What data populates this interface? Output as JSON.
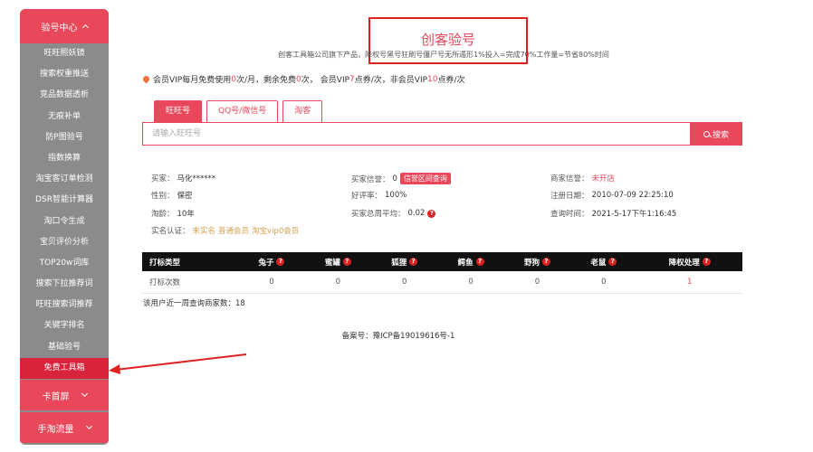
{
  "sidebar": {
    "header": "验号中心",
    "items": [
      "旺旺照妖镜",
      "搜索权重推送",
      "竞品数据透析",
      "无痕补单",
      "防P图验号",
      "指数换算",
      "淘宝客订单检测",
      "DSR智能计算器",
      "淘口令生成",
      "宝贝评价分析",
      "TOP20w词库",
      "搜索下拉推荐词",
      "旺旺搜索词推荐",
      "关键字排名",
      "基础验号",
      "免费工具箱"
    ],
    "active_index": 15,
    "footer": [
      "卡首屏",
      "手淘流量"
    ]
  },
  "header": {
    "title": "创客验号",
    "subtitle": "创客工具箱公司旗下产品，降权号黑号狂刷号僵尸号无所遁形1%投入=完成70%工作量=节省80%时间"
  },
  "vip": {
    "p1": "会员VIP每月免费使用",
    "free_count": "0",
    "p2": "次/月，剩余免费",
    "remain_count": "0",
    "p3": "次，",
    "p4": "会员VIP",
    "vip_points": "7",
    "p5": "点券/次，非会员VIP",
    "nonvip_points": "10",
    "p6": "点券/次"
  },
  "tabs": [
    "旺旺号",
    "QQ号/微信号",
    "淘客"
  ],
  "search": {
    "placeholder": "请输入旺旺号",
    "button": "搜索"
  },
  "info": {
    "buyer_label": "买家：",
    "buyer_value": "马化******",
    "gender_label": "性别：",
    "gender_value": "保密",
    "age_label": "淘龄：",
    "age_value": "10年",
    "auth_label": "实名认证：",
    "auth_tags": [
      "未实名",
      "普通会员",
      "淘宝vip0会员"
    ],
    "credit_label": "买家信誉：",
    "credit_value": "0",
    "credit_badge": "信誉区间查询",
    "good_label": "好评率：",
    "good_value": "100%",
    "week_avg_label": "买家总周平均：",
    "week_avg_value": "0.02",
    "seller_label": "商家信誉：",
    "seller_value": "未开店",
    "reg_label": "注册日期：",
    "reg_value": "2010-07-09 22:25:10",
    "query_label": "查询时间：",
    "query_value": "2021-5-17下午1:16:45"
  },
  "table": {
    "headers": [
      "打标类型",
      "兔子",
      "蜜罐",
      "狐狸",
      "鳄鱼",
      "野狗",
      "老鼠",
      "降权处理"
    ],
    "row": [
      "打标次数",
      "0",
      "0",
      "0",
      "0",
      "0",
      "0",
      "1"
    ]
  },
  "week_query": "该用户近一周查询商家数：18",
  "icp": "备案号：豫ICP备19019616号-1",
  "colors": {
    "accent": "#e8485a",
    "sidebar": "#8b8b8b",
    "highlight": "#e02020"
  }
}
